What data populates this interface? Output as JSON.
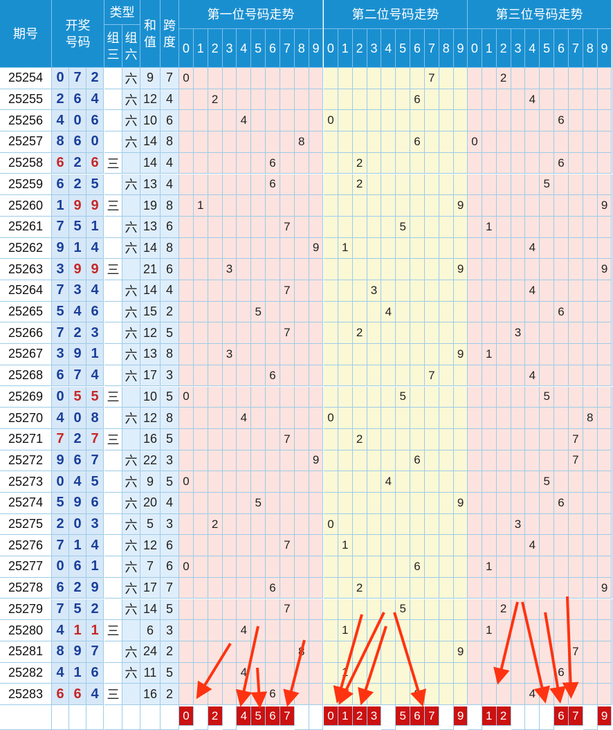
{
  "headers": {
    "period": "期号",
    "draw": "开奖\n号码",
    "type": "类型",
    "type_sub": [
      "组\n三",
      "组\n六"
    ],
    "sum": "和\n值",
    "span": "跨\n度",
    "trend_titles": [
      "第一位号码走势",
      "第二位号码走势",
      "第三位号码走势"
    ],
    "digits": [
      "0",
      "1",
      "2",
      "3",
      "4",
      "5",
      "6",
      "7",
      "8",
      "9"
    ]
  },
  "labels": {
    "zu3": "三",
    "zu6": "六"
  },
  "rows": [
    {
      "p": "25254",
      "n": [
        0,
        7,
        2
      ],
      "t": "六",
      "s": 9,
      "k": 7
    },
    {
      "p": "25255",
      "n": [
        2,
        6,
        4
      ],
      "t": "六",
      "s": 12,
      "k": 4
    },
    {
      "p": "25256",
      "n": [
        4,
        0,
        6
      ],
      "t": "六",
      "s": 10,
      "k": 6
    },
    {
      "p": "25257",
      "n": [
        8,
        6,
        0
      ],
      "t": "六",
      "s": 14,
      "k": 8
    },
    {
      "p": "25258",
      "n": [
        6,
        2,
        6
      ],
      "t": "三",
      "s": 14,
      "k": 4
    },
    {
      "p": "25259",
      "n": [
        6,
        2,
        5
      ],
      "t": "六",
      "s": 13,
      "k": 4
    },
    {
      "p": "25260",
      "n": [
        1,
        9,
        9
      ],
      "t": "三",
      "s": 19,
      "k": 8
    },
    {
      "p": "25261",
      "n": [
        7,
        5,
        1
      ],
      "t": "六",
      "s": 13,
      "k": 6
    },
    {
      "p": "25262",
      "n": [
        9,
        1,
        4
      ],
      "t": "六",
      "s": 14,
      "k": 8
    },
    {
      "p": "25263",
      "n": [
        3,
        9,
        9
      ],
      "t": "三",
      "s": 21,
      "k": 6
    },
    {
      "p": "25264",
      "n": [
        7,
        3,
        4
      ],
      "t": "六",
      "s": 14,
      "k": 4
    },
    {
      "p": "25265",
      "n": [
        5,
        4,
        6
      ],
      "t": "六",
      "s": 15,
      "k": 2
    },
    {
      "p": "25266",
      "n": [
        7,
        2,
        3
      ],
      "t": "六",
      "s": 12,
      "k": 5
    },
    {
      "p": "25267",
      "n": [
        3,
        9,
        1
      ],
      "t": "六",
      "s": 13,
      "k": 8
    },
    {
      "p": "25268",
      "n": [
        6,
        7,
        4
      ],
      "t": "六",
      "s": 17,
      "k": 3
    },
    {
      "p": "25269",
      "n": [
        0,
        5,
        5
      ],
      "t": "三",
      "s": 10,
      "k": 5
    },
    {
      "p": "25270",
      "n": [
        4,
        0,
        8
      ],
      "t": "六",
      "s": 12,
      "k": 8
    },
    {
      "p": "25271",
      "n": [
        7,
        2,
        7
      ],
      "t": "三",
      "s": 16,
      "k": 5
    },
    {
      "p": "25272",
      "n": [
        9,
        6,
        7
      ],
      "t": "六",
      "s": 22,
      "k": 3
    },
    {
      "p": "25273",
      "n": [
        0,
        4,
        5
      ],
      "t": "六",
      "s": 9,
      "k": 5
    },
    {
      "p": "25274",
      "n": [
        5,
        9,
        6
      ],
      "t": "六",
      "s": 20,
      "k": 4
    },
    {
      "p": "25275",
      "n": [
        2,
        0,
        3
      ],
      "t": "六",
      "s": 5,
      "k": 3
    },
    {
      "p": "25276",
      "n": [
        7,
        1,
        4
      ],
      "t": "六",
      "s": 12,
      "k": 6
    },
    {
      "p": "25277",
      "n": [
        0,
        6,
        1
      ],
      "t": "六",
      "s": 7,
      "k": 6
    },
    {
      "p": "25278",
      "n": [
        6,
        2,
        9
      ],
      "t": "六",
      "s": 17,
      "k": 7
    },
    {
      "p": "25279",
      "n": [
        7,
        5,
        2
      ],
      "t": "六",
      "s": 14,
      "k": 5
    },
    {
      "p": "25280",
      "n": [
        4,
        1,
        1
      ],
      "t": "三",
      "s": 6,
      "k": 3
    },
    {
      "p": "25281",
      "n": [
        8,
        9,
        7
      ],
      "t": "六",
      "s": 24,
      "k": 2
    },
    {
      "p": "25282",
      "n": [
        4,
        1,
        6
      ],
      "t": "六",
      "s": 11,
      "k": 5
    },
    {
      "p": "25283",
      "n": [
        6,
        6,
        4
      ],
      "t": "三",
      "s": 16,
      "k": 2
    }
  ],
  "predictions": [
    [
      "0",
      "2",
      "4",
      "5",
      "6",
      "7"
    ],
    [
      "0",
      "1",
      "2",
      "3",
      "5",
      "6",
      "7",
      "9"
    ],
    [
      "1",
      "2",
      "6",
      "7",
      "9"
    ]
  ],
  "colors": {
    "header": "#1a8fd0",
    "number": "#1a3f9a",
    "repeat": "#c62828",
    "zone_pink": "#fde3df",
    "zone_yellow": "#fbf8d6",
    "prediction": "#cc1111",
    "arrow": "#ff3311"
  }
}
